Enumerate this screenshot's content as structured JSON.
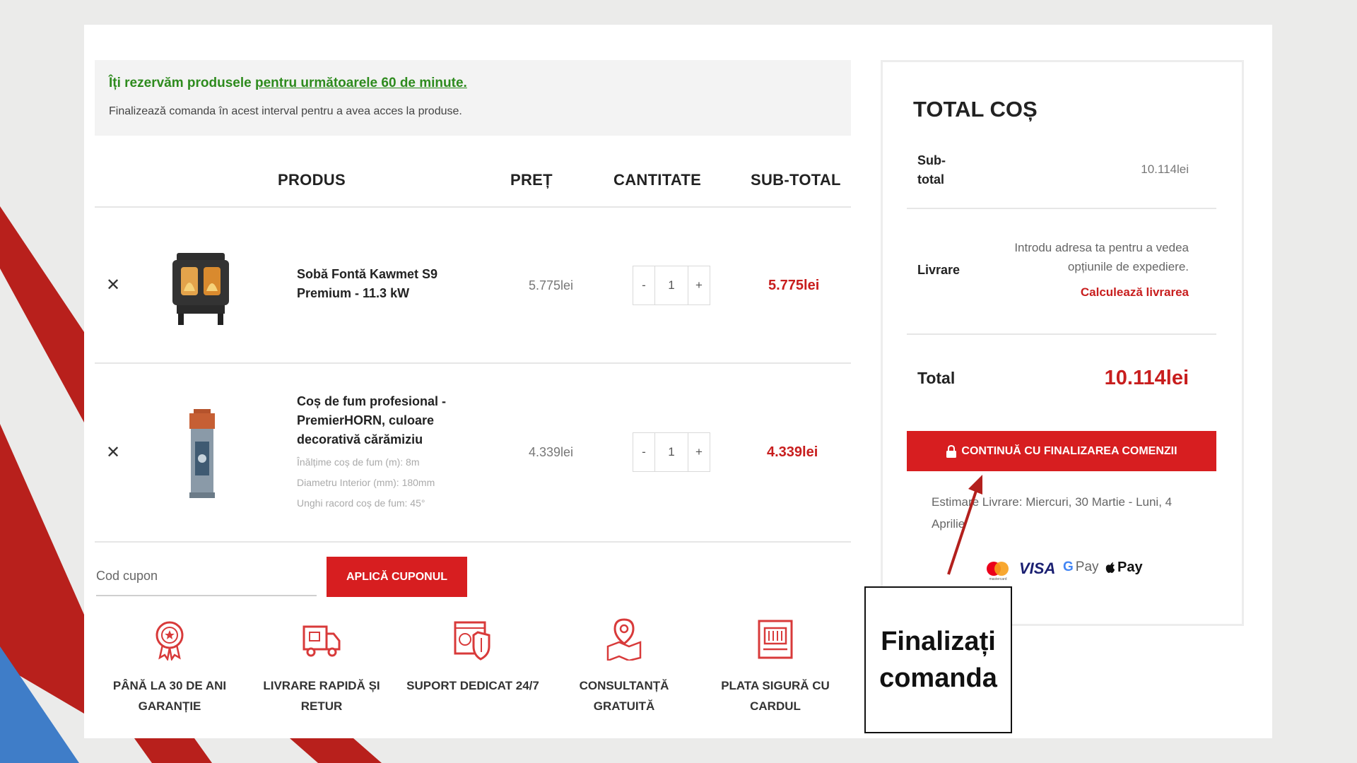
{
  "notice": {
    "title_prefix": "Îți rezervăm produsele ",
    "title_link": "pentru următoarele 60 de minute.",
    "subtitle": "Finalizează comanda în acest interval pentru a avea acces la produse."
  },
  "table": {
    "headers": {
      "product": "PRODUS",
      "price": "PREȚ",
      "quantity": "CANTITATE",
      "subtotal": "SUB-TOTAL"
    },
    "remove_symbol": "✕",
    "qty_minus": "-",
    "qty_plus": "+",
    "items": [
      {
        "name": "Sobă Fontă Kawmet S9 Premium - 11.3 kW",
        "attributes": [],
        "price": "5.775lei",
        "quantity": "1",
        "subtotal": "5.775lei",
        "thumbnail": "stove-icon"
      },
      {
        "name": "Coș de fum profesional - PremierHORN, culoare decorativă cărămiziu",
        "attributes": [
          "Înălțime coș de fum (m): 8m",
          "Diametru Interior (mm): 180mm",
          "Unghi racord coș de fum: 45°"
        ],
        "price": "4.339lei",
        "quantity": "1",
        "subtotal": "4.339lei",
        "thumbnail": "chimney-icon"
      }
    ]
  },
  "coupon": {
    "placeholder": "Cod cupon",
    "button_label": "APLICĂ CUPONUL"
  },
  "features": [
    {
      "icon": "award-icon",
      "label": "PÂNĂ LA 30 DE ANI GARANȚIE"
    },
    {
      "icon": "delivery-truck-icon",
      "label": "LIVRARE RAPIDĂ ȘI RETUR"
    },
    {
      "icon": "shield-support-icon",
      "label": "SUPORT DEDICAT 24/7"
    },
    {
      "icon": "consultation-pin-icon",
      "label": "CONSULTANȚĂ GRATUITĂ"
    },
    {
      "icon": "card-payment-icon",
      "label": "PLATA SIGURĂ CU CARDUL"
    }
  ],
  "totals": {
    "title": "TOTAL COȘ",
    "subtotal_label_line1": "Sub-",
    "subtotal_label_line2": "total",
    "subtotal_value": "10.114lei",
    "shipping_label": "Livrare",
    "shipping_info": "Introdu adresa ta pentru a vedea opțiunile de expediere.",
    "shipping_calc": "Calculează livrarea",
    "total_label": "Total",
    "total_value": "10.114lei",
    "checkout_label": "CONTINUĂ CU FINALIZAREA COMENZII",
    "estimate": "Estimare Livrare: Miercuri, 30 Martie - Luni, 4 Aprilie",
    "payment_methods": {
      "mastercard": "mastercard",
      "visa": "VISA",
      "gpay_g": "G",
      "gpay_text": "Pay",
      "applepay_text": "Pay"
    }
  },
  "callout": {
    "line1": "Finalizați",
    "line2": "comanda"
  },
  "colors": {
    "accent_red": "#d71e20",
    "price_red": "#c81e1e",
    "notice_green": "#2e8b1e",
    "stripe_blue": "#3f7dc8"
  }
}
